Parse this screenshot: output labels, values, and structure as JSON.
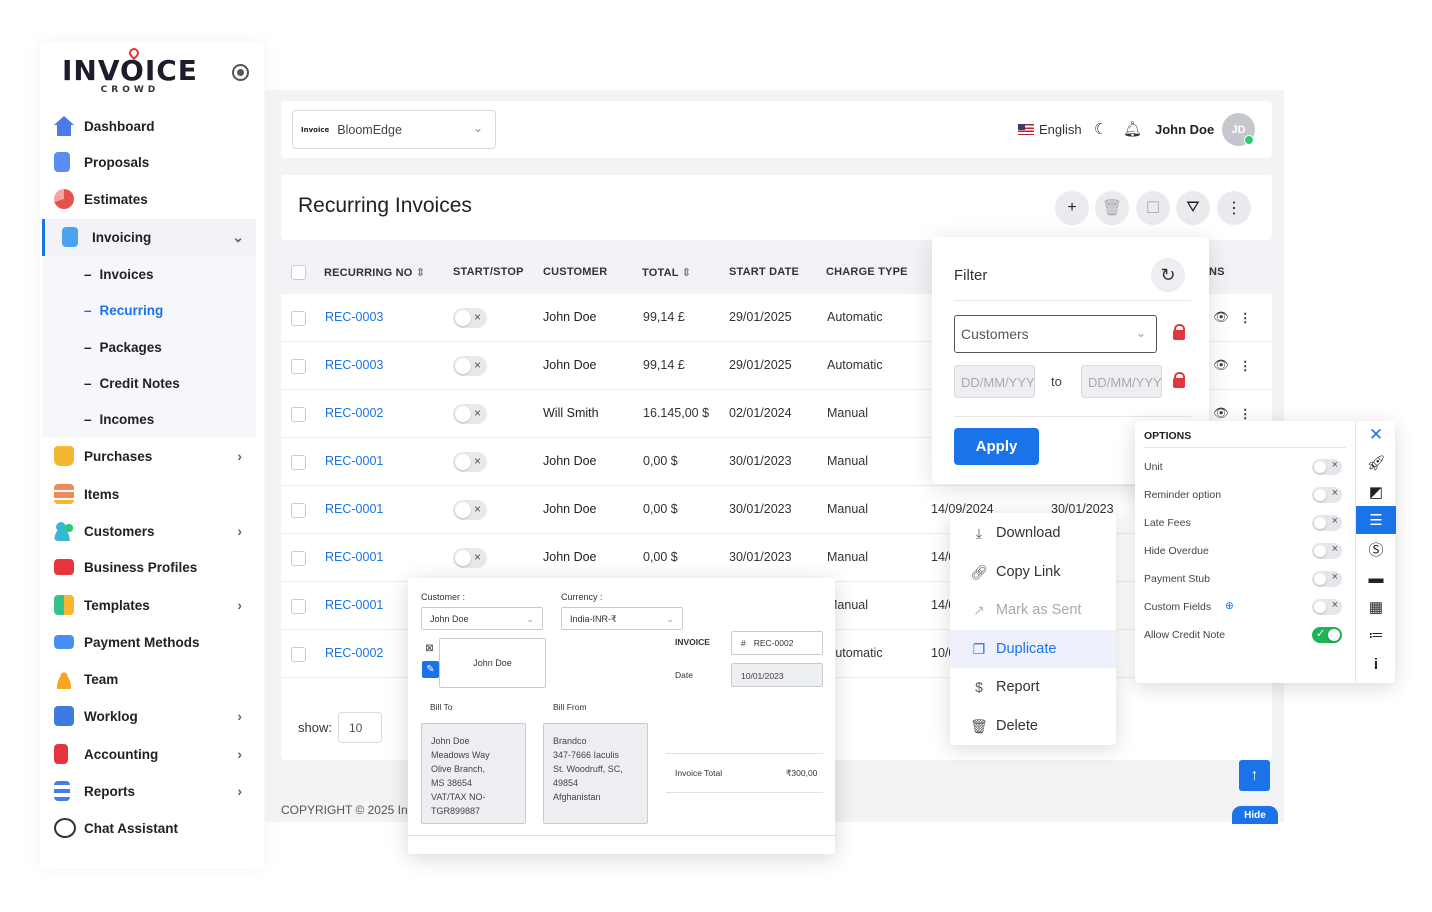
{
  "brand": {
    "name": "Invoice",
    "sub": "CROWD"
  },
  "sidebar": {
    "items": [
      {
        "label": "Dashboard",
        "color": "#4a7be8"
      },
      {
        "label": "Proposals",
        "color": "#5b8def"
      },
      {
        "label": "Estimates",
        "color": "#e5534b"
      },
      {
        "label": "Invoicing",
        "color": "#4aa3f0"
      },
      {
        "label": "Purchases",
        "color": "#f5b731"
      },
      {
        "label": "Items",
        "color": "#f08a5d"
      },
      {
        "label": "Customers",
        "color": "#38b6d6"
      },
      {
        "label": "Business Profiles",
        "color": "#e5343d"
      },
      {
        "label": "Templates",
        "color": "#36c28a"
      },
      {
        "label": "Payment Methods",
        "color": "#4a8ef0"
      },
      {
        "label": "Team",
        "color": "#f5a623"
      },
      {
        "label": "Worklog",
        "color": "#3d7be0"
      },
      {
        "label": "Accounting",
        "color": "#e5343d"
      },
      {
        "label": "Reports",
        "color": "#4a7be8"
      },
      {
        "label": "Chat Assistant",
        "color": "#333333"
      }
    ],
    "submenu": [
      "Invoices",
      "Recurring",
      "Packages",
      "Credit Notes",
      "Incomes"
    ]
  },
  "topbar": {
    "company": "BloomEdge",
    "language": "English",
    "user": "John Doe",
    "initials": "JD"
  },
  "page": {
    "title": "Recurring Invoices"
  },
  "table": {
    "headers": [
      "RECURRING NO",
      "START/STOP",
      "CUSTOMER",
      "TOTAL",
      "START DATE",
      "CHARGE TYPE",
      "NS"
    ],
    "rows": [
      {
        "no": "REC-0003",
        "customer": "John Doe",
        "total": "99,14 £",
        "start": "29/01/2025",
        "type": "Automatic",
        "d1": "",
        "d2": ""
      },
      {
        "no": "REC-0003",
        "customer": "John Doe",
        "total": "99,14 £",
        "start": "29/01/2025",
        "type": "Automatic",
        "d1": "",
        "d2": ""
      },
      {
        "no": "REC-0002",
        "customer": "Will Smith",
        "total": "16.145,00 $",
        "start": "02/01/2024",
        "type": "Manual",
        "d1": "",
        "d2": ""
      },
      {
        "no": "REC-0001",
        "customer": "John Doe",
        "total": "0,00 $",
        "start": "30/01/2023",
        "type": "Manual",
        "d1": "",
        "d2": ""
      },
      {
        "no": "REC-0001",
        "customer": "John Doe",
        "total": "0,00 $",
        "start": "30/01/2023",
        "type": "Manual",
        "d1": "14/09/2024",
        "d2": "30/01/2023"
      },
      {
        "no": "REC-0001",
        "customer": "John Doe",
        "total": "0,00 $",
        "start": "30/01/2023",
        "type": "Manual",
        "d1": "14/0",
        "d2": ""
      },
      {
        "no": "REC-0001",
        "customer": "",
        "total": "",
        "start": "",
        "type": "Manual",
        "d1": "14/0",
        "d2": ""
      },
      {
        "no": "REC-0002",
        "customer": "",
        "total": "",
        "start": "",
        "type": "Automatic",
        "d1": "10/0",
        "d2": ""
      }
    ],
    "show_label": "show:",
    "show_value": "10"
  },
  "footer": "COPYRIGHT © 2025 In",
  "filter": {
    "title": "Filter",
    "customers": "Customers",
    "date_placeholder": "DD/MM/YYYY",
    "to": "to",
    "apply": "Apply"
  },
  "menu": [
    "Download",
    "Copy Link",
    "Mark as Sent",
    "Duplicate",
    "Report",
    "Delete"
  ],
  "options": {
    "title": "OPTIONS",
    "items": [
      "Unit",
      "Reminder option",
      "Late Fees",
      "Hide Overdue",
      "Payment Stub",
      "Custom Fields",
      "Allow Credit Note"
    ]
  },
  "preview": {
    "customer_label": "Customer :",
    "customer_value": "John Doe",
    "currency_label": "Currency :",
    "currency_value": "India-INR-₹",
    "card_name": "John Doe",
    "invoice_label": "INVOICE",
    "invoice_no": "REC-0002",
    "date_label": "Date",
    "date_value": "10/01/2023",
    "bill_to_label": "Bill To",
    "bill_from_label": "Bill From",
    "bill_to": [
      "John Doe",
      "Meadows Way",
      "Olive Branch,",
      "MS 38654",
      "VAT/TAX NO-",
      "TGR899887"
    ],
    "bill_from": [
      "Brandco",
      "347-7666 Iaculis",
      "St. Woodruff, SC,",
      "49854",
      "Afghanistan"
    ],
    "total_label": "Invoice Total",
    "total_value": "₹300,00"
  },
  "hide_label": "Hide"
}
